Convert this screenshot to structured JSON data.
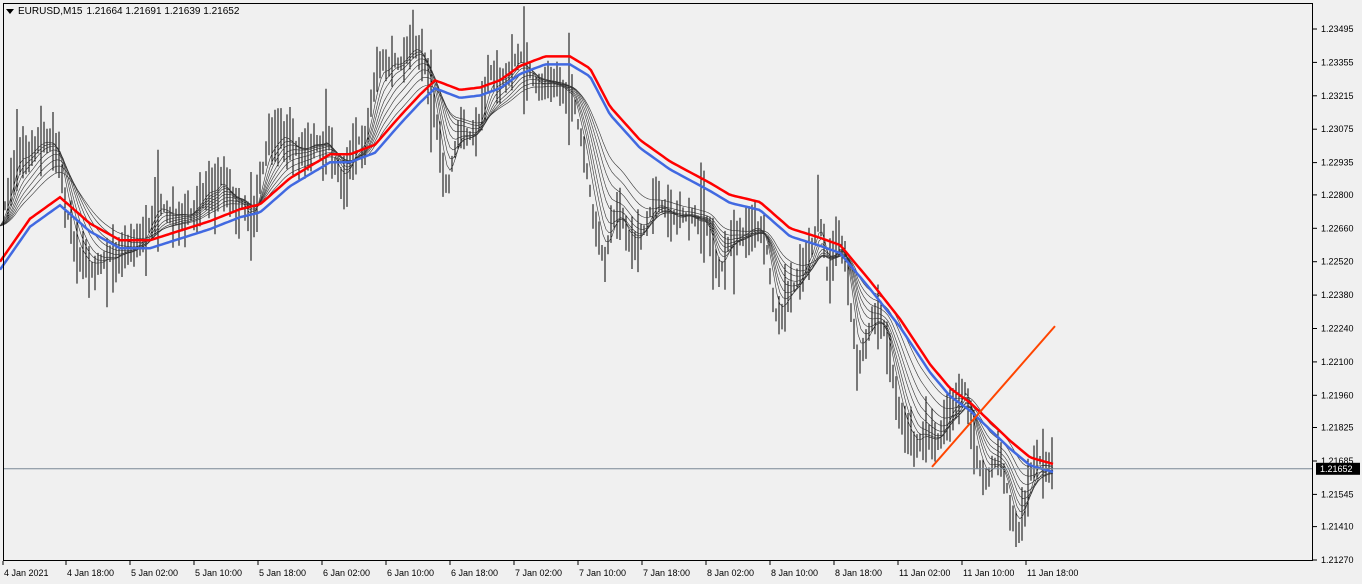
{
  "symbol": {
    "name": "EURUSD,M15",
    "ohlc": "1.21664 1.21691 1.21639 1.21652"
  },
  "colors": {
    "background": "#f0f0f0",
    "bars": "#000000",
    "ema_slow": "#ff0000",
    "ema_blue": "#4169e1",
    "ema_thin": "#333333",
    "trendline": "#ff4500",
    "current_price_line": "#7a8896",
    "current_price_tag": "#000000"
  },
  "chart_data": {
    "type": "ohlc_bars",
    "title": "EURUSD,M15",
    "y_ticks": [
      "1.23495",
      "1.23355",
      "1.23215",
      "1.23075",
      "1.22935",
      "1.22800",
      "1.22660",
      "1.22520",
      "1.22380",
      "1.22240",
      "1.22100",
      "1.21960",
      "1.21825",
      "1.21685",
      "1.21545",
      "1.21410",
      "1.21270"
    ],
    "y_range": [
      1.2121,
      1.2355
    ],
    "x_labels": [
      "4 Jan 2021",
      "4 Jan 18:00",
      "5 Jan 02:00",
      "5 Jan 10:00",
      "5 Jan 18:00",
      "6 Jan 02:00",
      "6 Jan 10:00",
      "6 Jan 18:00",
      "7 Jan 02:00",
      "7 Jan 10:00",
      "7 Jan 18:00",
      "8 Jan 02:00",
      "8 Jan 10:00",
      "8 Jan 18:00",
      "11 Jan 02:00",
      "11 Jan 10:00",
      "11 Jan 18:00"
    ],
    "current_price": "1.21652",
    "grid": false,
    "price_path": [
      [
        0,
        1.2267
      ],
      [
        12,
        1.2287
      ],
      [
        18,
        1.2299
      ],
      [
        28,
        1.2296
      ],
      [
        38,
        1.2302
      ],
      [
        46,
        1.2303
      ],
      [
        54,
        1.2301
      ],
      [
        60,
        1.2293
      ],
      [
        66,
        1.2275
      ],
      [
        72,
        1.2264
      ],
      [
        78,
        1.2255
      ],
      [
        84,
        1.2252
      ],
      [
        90,
        1.225
      ],
      [
        96,
        1.2251
      ],
      [
        102,
        1.2252
      ],
      [
        108,
        1.2254
      ],
      [
        114,
        1.2253
      ],
      [
        120,
        1.2256
      ],
      [
        126,
        1.2257
      ],
      [
        132,
        1.2257
      ],
      [
        138,
        1.226
      ],
      [
        146,
        1.2263
      ],
      [
        154,
        1.2274
      ],
      [
        160,
        1.2277
      ],
      [
        166,
        1.2273
      ],
      [
        174,
        1.2271
      ],
      [
        182,
        1.2272
      ],
      [
        190,
        1.2271
      ],
      [
        196,
        1.2275
      ],
      [
        202,
        1.2279
      ],
      [
        208,
        1.2283
      ],
      [
        216,
        1.2282
      ],
      [
        222,
        1.2287
      ],
      [
        228,
        1.2281
      ],
      [
        236,
        1.2275
      ],
      [
        244,
        1.2276
      ],
      [
        250,
        1.2268
      ],
      [
        256,
        1.2275
      ],
      [
        262,
        1.229
      ],
      [
        268,
        1.2301
      ],
      [
        276,
        1.2303
      ],
      [
        284,
        1.2306
      ],
      [
        290,
        1.2302
      ],
      [
        298,
        1.2298
      ],
      [
        306,
        1.2299
      ],
      [
        314,
        1.2302
      ],
      [
        322,
        1.2301
      ],
      [
        328,
        1.2303
      ],
      [
        334,
        1.2293
      ],
      [
        340,
        1.2287
      ],
      [
        346,
        1.2287
      ],
      [
        352,
        1.2296
      ],
      [
        358,
        1.2303
      ],
      [
        364,
        1.23
      ],
      [
        370,
        1.2315
      ],
      [
        376,
        1.233
      ],
      [
        382,
        1.2337
      ],
      [
        388,
        1.2332
      ],
      [
        394,
        1.2337
      ],
      [
        400,
        1.2334
      ],
      [
        406,
        1.2338
      ],
      [
        412,
        1.2342
      ],
      [
        418,
        1.2342
      ],
      [
        424,
        1.2336
      ],
      [
        430,
        1.2324
      ],
      [
        436,
        1.231
      ],
      [
        442,
        1.229
      ],
      [
        448,
        1.2282
      ],
      [
        454,
        1.2298
      ],
      [
        460,
        1.2309
      ],
      [
        466,
        1.2305
      ],
      [
        472,
        1.2305
      ],
      [
        478,
        1.2308
      ],
      [
        484,
        1.232
      ],
      [
        490,
        1.233
      ],
      [
        496,
        1.233
      ],
      [
        502,
        1.2328
      ],
      [
        508,
        1.233
      ],
      [
        514,
        1.2335
      ],
      [
        520,
        1.2338
      ],
      [
        526,
        1.2333
      ],
      [
        532,
        1.233
      ],
      [
        538,
        1.2325
      ],
      [
        544,
        1.2326
      ],
      [
        550,
        1.2327
      ],
      [
        556,
        1.2326
      ],
      [
        562,
        1.2325
      ],
      [
        568,
        1.2322
      ],
      [
        574,
        1.232
      ],
      [
        580,
        1.2305
      ],
      [
        586,
        1.2293
      ],
      [
        592,
        1.2275
      ],
      [
        598,
        1.2263
      ],
      [
        604,
        1.2253
      ],
      [
        610,
        1.2262
      ],
      [
        616,
        1.2274
      ],
      [
        622,
        1.2272
      ],
      [
        628,
        1.2262
      ],
      [
        634,
        1.226
      ],
      [
        640,
        1.2262
      ],
      [
        646,
        1.2268
      ],
      [
        652,
        1.2275
      ],
      [
        658,
        1.2278
      ],
      [
        664,
        1.2275
      ],
      [
        670,
        1.2272
      ],
      [
        676,
        1.227
      ],
      [
        682,
        1.227
      ],
      [
        688,
        1.2272
      ],
      [
        694,
        1.227
      ],
      [
        700,
        1.2268
      ],
      [
        706,
        1.2269
      ],
      [
        712,
        1.226
      ],
      [
        718,
        1.2245
      ],
      [
        724,
        1.2252
      ],
      [
        730,
        1.2261
      ],
      [
        736,
        1.2264
      ],
      [
        742,
        1.2263
      ],
      [
        748,
        1.2265
      ],
      [
        754,
        1.2267
      ],
      [
        760,
        1.2266
      ],
      [
        766,
        1.226
      ],
      [
        772,
        1.224
      ],
      [
        778,
        1.2225
      ],
      [
        784,
        1.2233
      ],
      [
        790,
        1.224
      ],
      [
        796,
        1.2243
      ],
      [
        802,
        1.2248
      ],
      [
        808,
        1.2255
      ],
      [
        814,
        1.2261
      ],
      [
        818,
        1.2272
      ],
      [
        822,
        1.2265
      ],
      [
        828,
        1.2245
      ],
      [
        834,
        1.2255
      ],
      [
        840,
        1.226
      ],
      [
        846,
        1.2252
      ],
      [
        852,
        1.2228
      ],
      [
        858,
        1.2207
      ],
      [
        864,
        1.2218
      ],
      [
        870,
        1.2224
      ],
      [
        876,
        1.223
      ],
      [
        882,
        1.2226
      ],
      [
        888,
        1.2218
      ],
      [
        894,
        1.22
      ],
      [
        900,
        1.219
      ],
      [
        906,
        1.218
      ],
      [
        912,
        1.2177
      ],
      [
        918,
        1.2175
      ],
      [
        924,
        1.218
      ],
      [
        930,
        1.2178
      ],
      [
        936,
        1.2177
      ],
      [
        942,
        1.218
      ],
      [
        948,
        1.2188
      ],
      [
        954,
        1.2193
      ],
      [
        960,
        1.2195
      ],
      [
        966,
        1.22
      ],
      [
        970,
        1.219
      ],
      [
        976,
        1.217
      ],
      [
        982,
        1.2163
      ],
      [
        988,
        1.216
      ],
      [
        994,
        1.2168
      ],
      [
        1000,
        1.2167
      ],
      [
        1006,
        1.216
      ],
      [
        1012,
        1.2145
      ],
      [
        1018,
        1.2138
      ],
      [
        1024,
        1.215
      ],
      [
        1030,
        1.2162
      ],
      [
        1036,
        1.217
      ],
      [
        1042,
        1.2168
      ],
      [
        1048,
        1.2166
      ],
      [
        1052,
        1.2165
      ]
    ],
    "ema_slow_path": [
      [
        0,
        1.2252
      ],
      [
        30,
        1.227
      ],
      [
        60,
        1.2279
      ],
      [
        90,
        1.2268
      ],
      [
        120,
        1.2261
      ],
      [
        150,
        1.2261
      ],
      [
        180,
        1.2265
      ],
      [
        210,
        1.2269
      ],
      [
        240,
        1.2274
      ],
      [
        260,
        1.2276
      ],
      [
        290,
        1.2287
      ],
      [
        330,
        1.2297
      ],
      [
        350,
        1.2297
      ],
      [
        375,
        1.2301
      ],
      [
        400,
        1.2313
      ],
      [
        420,
        1.2322
      ],
      [
        435,
        1.2328
      ],
      [
        460,
        1.2324
      ],
      [
        480,
        1.2325
      ],
      [
        500,
        1.2328
      ],
      [
        520,
        1.2334
      ],
      [
        545,
        1.2338
      ],
      [
        570,
        1.2338
      ],
      [
        590,
        1.2333
      ],
      [
        610,
        1.2317
      ],
      [
        640,
        1.2303
      ],
      [
        670,
        1.2294
      ],
      [
        710,
        1.2285
      ],
      [
        730,
        1.228
      ],
      [
        760,
        1.2277
      ],
      [
        790,
        1.2266
      ],
      [
        820,
        1.2262
      ],
      [
        840,
        1.2259
      ],
      [
        870,
        1.2244
      ],
      [
        900,
        1.2228
      ],
      [
        930,
        1.2209
      ],
      [
        950,
        1.2199
      ],
      [
        970,
        1.2193
      ],
      [
        990,
        1.2185
      ],
      [
        1010,
        1.2177
      ],
      [
        1030,
        1.217
      ],
      [
        1055,
        1.2167
      ]
    ],
    "trendline": {
      "from": [
        932,
        1.2166
      ],
      "to": [
        1055,
        1.2225
      ]
    }
  }
}
